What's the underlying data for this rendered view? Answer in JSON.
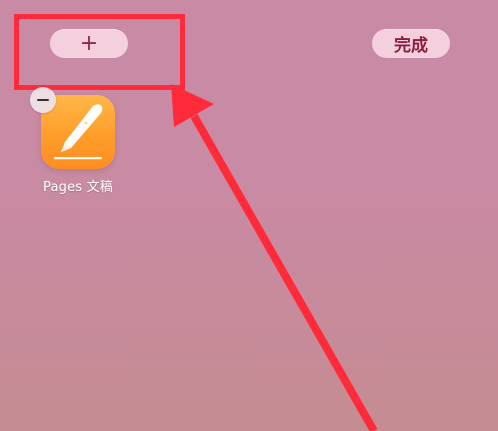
{
  "topbar": {
    "add_label": "+",
    "done_label": "完成"
  },
  "app": {
    "name": "Pages 文稿",
    "icon": "pages-icon"
  },
  "annotation": {
    "highlight_color": "#ff2b3a"
  },
  "colors": {
    "wallpaper_top": "#c98aa6",
    "wallpaper_bottom": "#c58c92",
    "pill_bg": "#f7d6e4",
    "pill_text": "#8b1d3d",
    "pages_orange": "#ff9d2b"
  }
}
